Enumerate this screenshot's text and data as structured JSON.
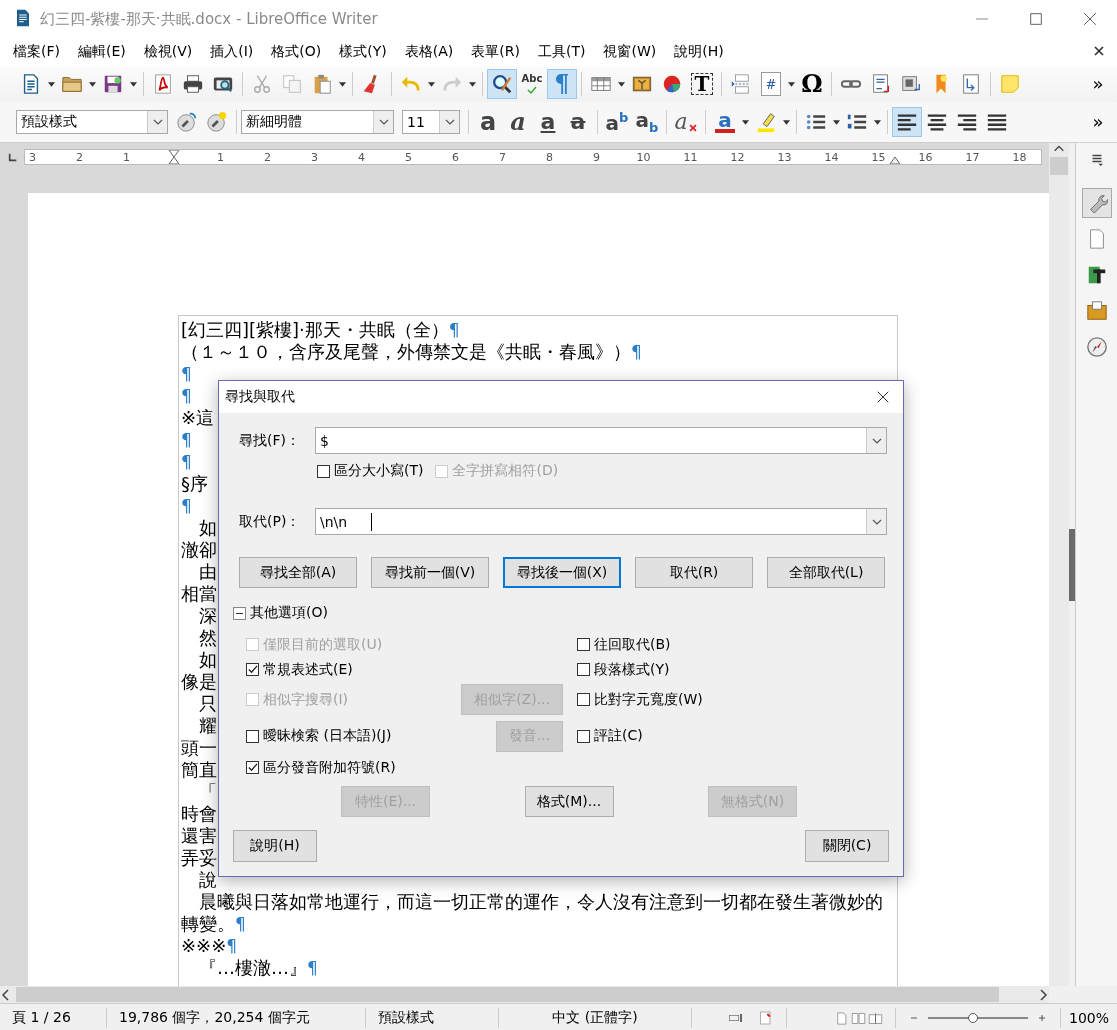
{
  "window": {
    "title": "幻三四-紫樓-那天·共眠.docx - LibreOffice Writer"
  },
  "menu": [
    "檔案(F)",
    "編輯(E)",
    "檢視(V)",
    "插入(I)",
    "格式(O)",
    "樣式(Y)",
    "表格(A)",
    "表單(R)",
    "工具(T)",
    "視窗(W)",
    "說明(H)"
  ],
  "standard_toolbar": [
    {
      "kind": "new",
      "dropdown": true,
      "on": false
    },
    {
      "kind": "open",
      "dropdown": true,
      "on": false
    },
    {
      "kind": "save",
      "dropdown": true,
      "on": false
    },
    {
      "kind": "separator"
    },
    {
      "kind": "pdf",
      "on": false
    },
    {
      "kind": "print",
      "on": false
    },
    {
      "kind": "preview",
      "on": false
    },
    {
      "kind": "separator"
    },
    {
      "kind": "cut",
      "on": false
    },
    {
      "kind": "copy",
      "on": false
    },
    {
      "kind": "paste",
      "dropdown": true,
      "on": false
    },
    {
      "kind": "separator"
    },
    {
      "kind": "clone",
      "on": false
    },
    {
      "kind": "separator"
    },
    {
      "kind": "undo",
      "dropdown": true,
      "on": false
    },
    {
      "kind": "redo",
      "dropdown": true,
      "on": false
    },
    {
      "kind": "separator"
    },
    {
      "kind": "find",
      "on": true
    },
    {
      "kind": "spell",
      "glyph": "Abc",
      "on": false
    },
    {
      "kind": "pilcrow",
      "glyph": "¶",
      "on": true
    },
    {
      "kind": "separator"
    },
    {
      "kind": "table",
      "dropdown": true,
      "on": false
    },
    {
      "kind": "image",
      "on": false
    },
    {
      "kind": "chart",
      "on": false
    },
    {
      "kind": "textbox",
      "glyph": "T",
      "on": false
    },
    {
      "kind": "separator"
    },
    {
      "kind": "pagebreak",
      "on": false
    },
    {
      "kind": "field",
      "glyph": "#",
      "dropdown": true,
      "on": false
    },
    {
      "kind": "special",
      "glyph": "Ω",
      "on": false
    },
    {
      "kind": "separator"
    },
    {
      "kind": "link",
      "on": false
    },
    {
      "kind": "footnote",
      "on": false
    },
    {
      "kind": "endnote",
      "on": false
    },
    {
      "kind": "bookmark",
      "on": false
    },
    {
      "kind": "crossref",
      "on": false
    },
    {
      "kind": "separator"
    },
    {
      "kind": "comment",
      "on": false
    },
    {
      "kind": "more",
      "glyph": "»"
    }
  ],
  "formatting_toolbar": {
    "paragraph_style": "預設樣式",
    "font_name": "新細明體",
    "font_size": "11",
    "buttons": [
      {
        "kind": "bold",
        "glyph": "a",
        "on": false
      },
      {
        "kind": "italic",
        "glyph": "a",
        "on": false
      },
      {
        "kind": "underline",
        "glyph": "a",
        "on": false
      },
      {
        "kind": "strike",
        "glyph": "a",
        "on": false
      },
      {
        "kind": "separator"
      },
      {
        "kind": "superscript",
        "glyph": "a$^{b}$",
        "on": false
      },
      {
        "kind": "subscript",
        "glyph": "a$_{b}$",
        "on": false
      },
      {
        "kind": "separator"
      },
      {
        "kind": "clear",
        "glyph": "a",
        "on": false
      },
      {
        "kind": "separator"
      },
      {
        "kind": "fontcolor",
        "glyph": "a",
        "dropdown": true,
        "on": false
      },
      {
        "kind": "highlight",
        "dropdown": true,
        "on": false
      },
      {
        "kind": "separator"
      },
      {
        "kind": "bullets",
        "dropdown": true,
        "on": false
      },
      {
        "kind": "numbering",
        "dropdown": true,
        "on": false
      },
      {
        "kind": "separator"
      },
      {
        "kind": "alignleft",
        "on": true
      },
      {
        "kind": "aligncenter",
        "on": false
      },
      {
        "kind": "alignright",
        "on": false
      },
      {
        "kind": "justify",
        "on": false
      },
      {
        "kind": "more",
        "glyph": "»"
      }
    ]
  },
  "ruler": {
    "left_labels": [
      "3",
      "2",
      "1"
    ],
    "right_labels": [
      "1",
      "2",
      "3",
      "4",
      "5",
      "6",
      "7",
      "8",
      "9",
      "10",
      "11",
      "12",
      "13",
      "14",
      "15",
      "16",
      "17",
      "18"
    ]
  },
  "document": {
    "lines": [
      {
        "text": "[幻三四][紫樓]·那天・共眠（全）",
        "end": "¶"
      },
      {
        "text": "（１～１０，含序及尾聲，外傳禁文是《共眠・春風》）",
        "end": "¶"
      },
      {
        "end": "¶"
      },
      {
        "end": "¶"
      },
      {
        "text": "※這"
      },
      {
        "end": "¶"
      },
      {
        "end": "¶"
      },
      {
        "text": "§序"
      },
      {
        "end": "¶"
      },
      {
        "text": "　如"
      },
      {
        "text": "澈卻"
      },
      {
        "text": "　由"
      },
      {
        "text": "相當"
      },
      {
        "text": "　深"
      },
      {
        "text": "　然"
      },
      {
        "text": "　如"
      },
      {
        "text": "像是"
      },
      {
        "text": "　只"
      },
      {
        "text": "　耀"
      },
      {
        "text": "頭一"
      },
      {
        "text": "簡直"
      },
      {
        "text": "　「"
      },
      {
        "text": "時會"
      },
      {
        "text": "還害"
      },
      {
        "text": "弄妥"
      },
      {
        "text": "　說"
      },
      {
        "text": "　晨曦與日落如常地運行，而這一切正常的運作，令人沒有注意到一切都在發生著微妙的"
      },
      {
        "text": "轉變。",
        "end": "¶"
      },
      {
        "text": "※※※",
        "end": "¶"
      },
      {
        "text": "　『…樓澈…』",
        "end": "¶"
      }
    ]
  },
  "sidebar": {
    "tabs": [
      {
        "kind": "properties",
        "selected": true
      },
      {
        "kind": "page",
        "selected": false
      },
      {
        "kind": "styles",
        "selected": false
      },
      {
        "kind": "gallery",
        "selected": false
      },
      {
        "kind": "navigator",
        "selected": false
      }
    ]
  },
  "dialog": {
    "title": "尋找與取代",
    "find": {
      "label": "尋找(F)：",
      "value": "$"
    },
    "find_options": [
      {
        "label": "區分大小寫(T)",
        "checked": false,
        "disabled": false
      },
      {
        "label": "全字拼寫相符(D)",
        "checked": false,
        "disabled": true
      }
    ],
    "replace": {
      "label": "取代(P)：",
      "value": "\\n\\n"
    },
    "buttons": [
      {
        "label": "尋找全部(A)",
        "default": false
      },
      {
        "label": "尋找前一個(V)",
        "default": false
      },
      {
        "label": "尋找後一個(X)",
        "default": true
      },
      {
        "label": "取代(R)",
        "default": false
      },
      {
        "label": "全部取代(L)",
        "default": false
      }
    ],
    "more_options": {
      "label": "其他選項(O)",
      "expanded": true
    },
    "options_left": [
      {
        "label": "僅限目前的選取(U)",
        "checked": false,
        "disabled": true
      },
      {
        "label": "常規表述式(E)",
        "checked": true,
        "disabled": false
      },
      {
        "label": "相似字搜尋(I)",
        "checked": false,
        "disabled": true,
        "button": {
          "label": "相似字(Z)...",
          "disabled": true
        }
      },
      {
        "label": "曖昧検索 (日本語)(J)",
        "checked": false,
        "disabled": false,
        "button": {
          "label": "發音...",
          "disabled": true
        }
      },
      {
        "label": "區分發音附加符號(R)",
        "checked": true,
        "disabled": false
      }
    ],
    "options_right": [
      {
        "label": "往回取代(B)",
        "checked": false,
        "disabled": false
      },
      {
        "label": "段落樣式(Y)",
        "checked": false,
        "disabled": false
      },
      {
        "label": "比對字元寬度(W)",
        "checked": false,
        "disabled": false
      },
      {
        "label": "評註(C)",
        "checked": false,
        "disabled": false
      }
    ],
    "attribute_buttons": [
      {
        "label": "特性(E)...",
        "disabled": true
      },
      {
        "label": "格式(M)...",
        "disabled": false
      },
      {
        "label": "無格式(N)",
        "disabled": true
      }
    ],
    "help_button": "說明(H)",
    "close_button": "關閉(C)"
  },
  "status_bar": {
    "page": "頁 1 / 26",
    "word_count": "19,786 個字，20,254 個字元",
    "page_style": "預設樣式",
    "language": "中文 (正體字)",
    "zoom": {
      "level": 0.45,
      "reading": "100%"
    }
  }
}
